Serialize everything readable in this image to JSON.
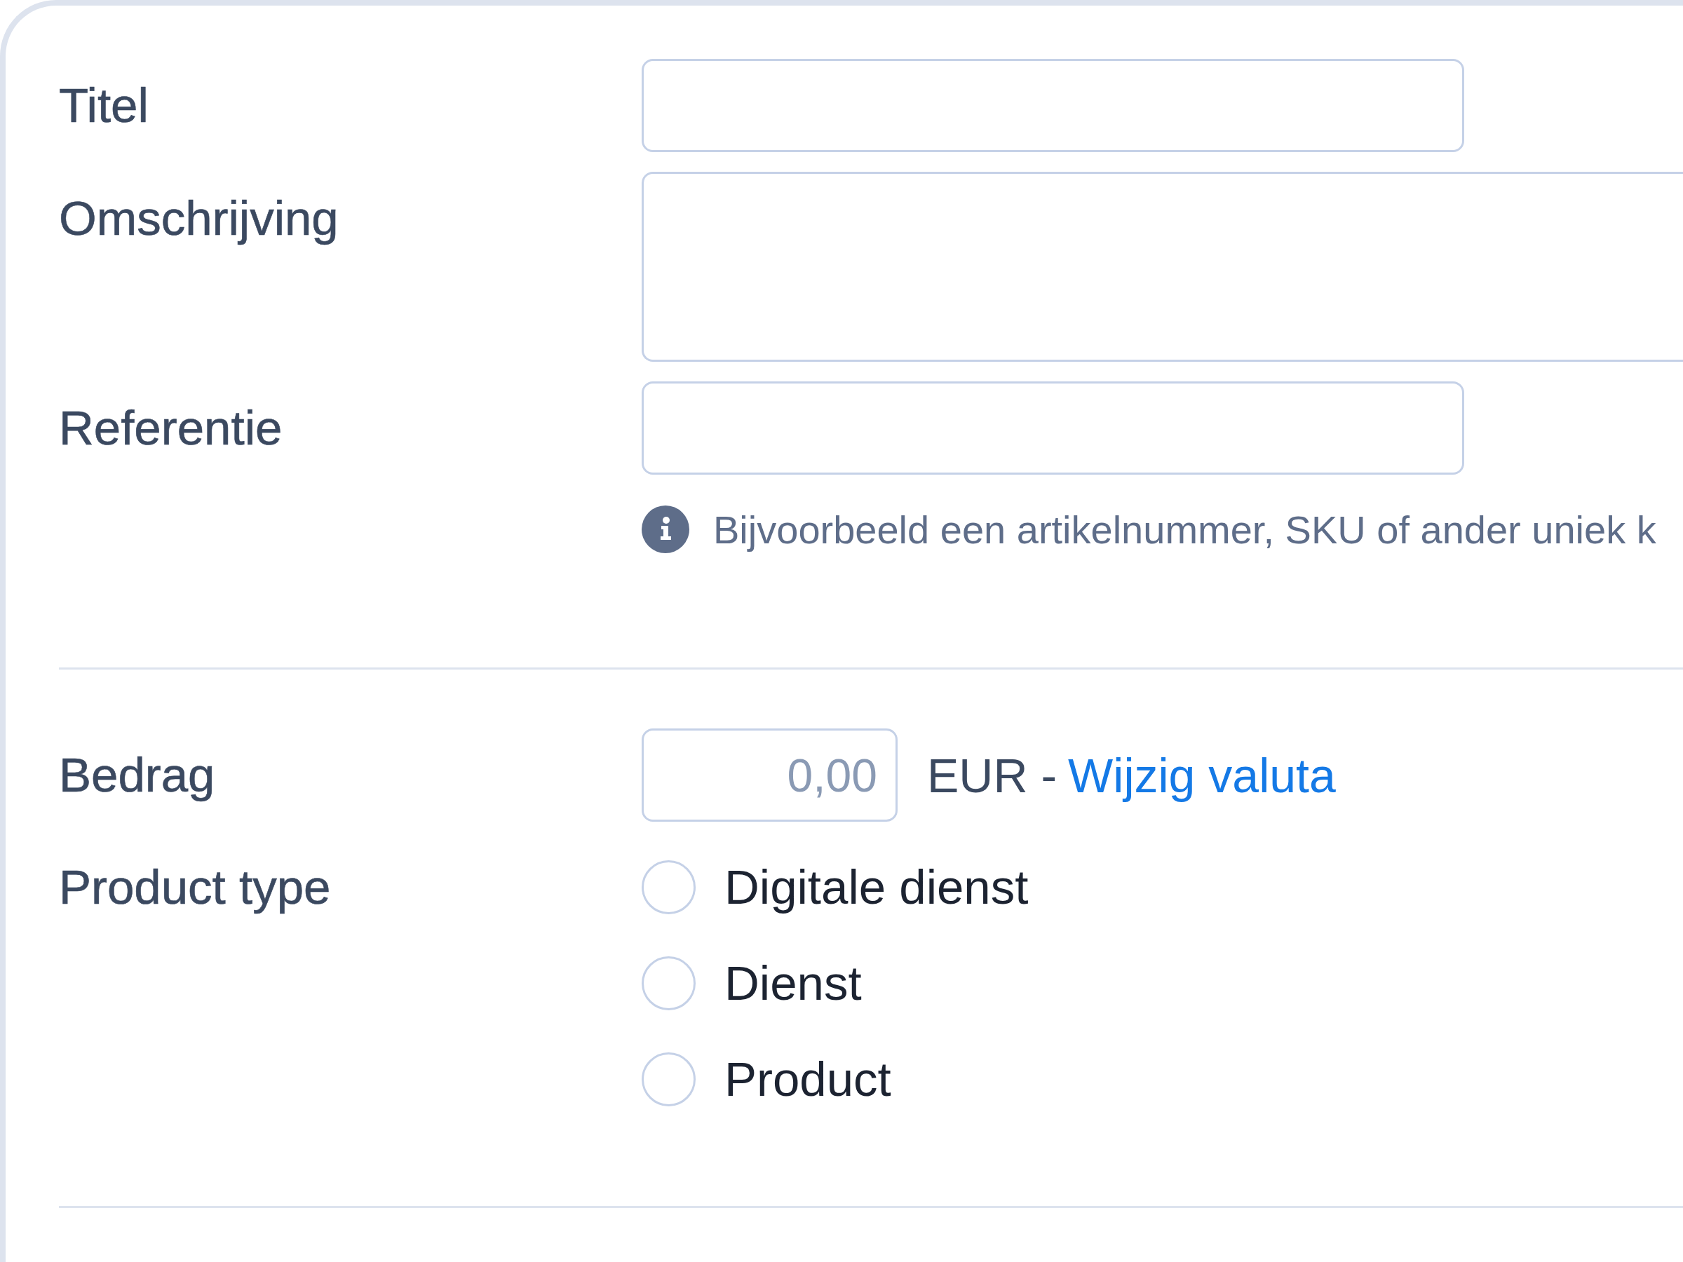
{
  "fields": [
    {
      "label": "Titel",
      "kind": "text"
    },
    {
      "label": "Omschrijving",
      "kind": "textarea"
    },
    {
      "label": "Referentie",
      "kind": "text",
      "hint": "Bijvoorbeeld een artikelnummer, SKU of ander uniek k"
    }
  ],
  "amount": {
    "label": "Bedrag",
    "placeholder": "0,00",
    "currency": "EUR -",
    "link": "Wijzig valuta"
  },
  "product_type": {
    "label": "Product type",
    "options": [
      {
        "label": "Digitale dienst",
        "selected": false
      },
      {
        "label": "Dienst",
        "selected": false
      },
      {
        "label": "Product",
        "selected": false
      }
    ]
  }
}
